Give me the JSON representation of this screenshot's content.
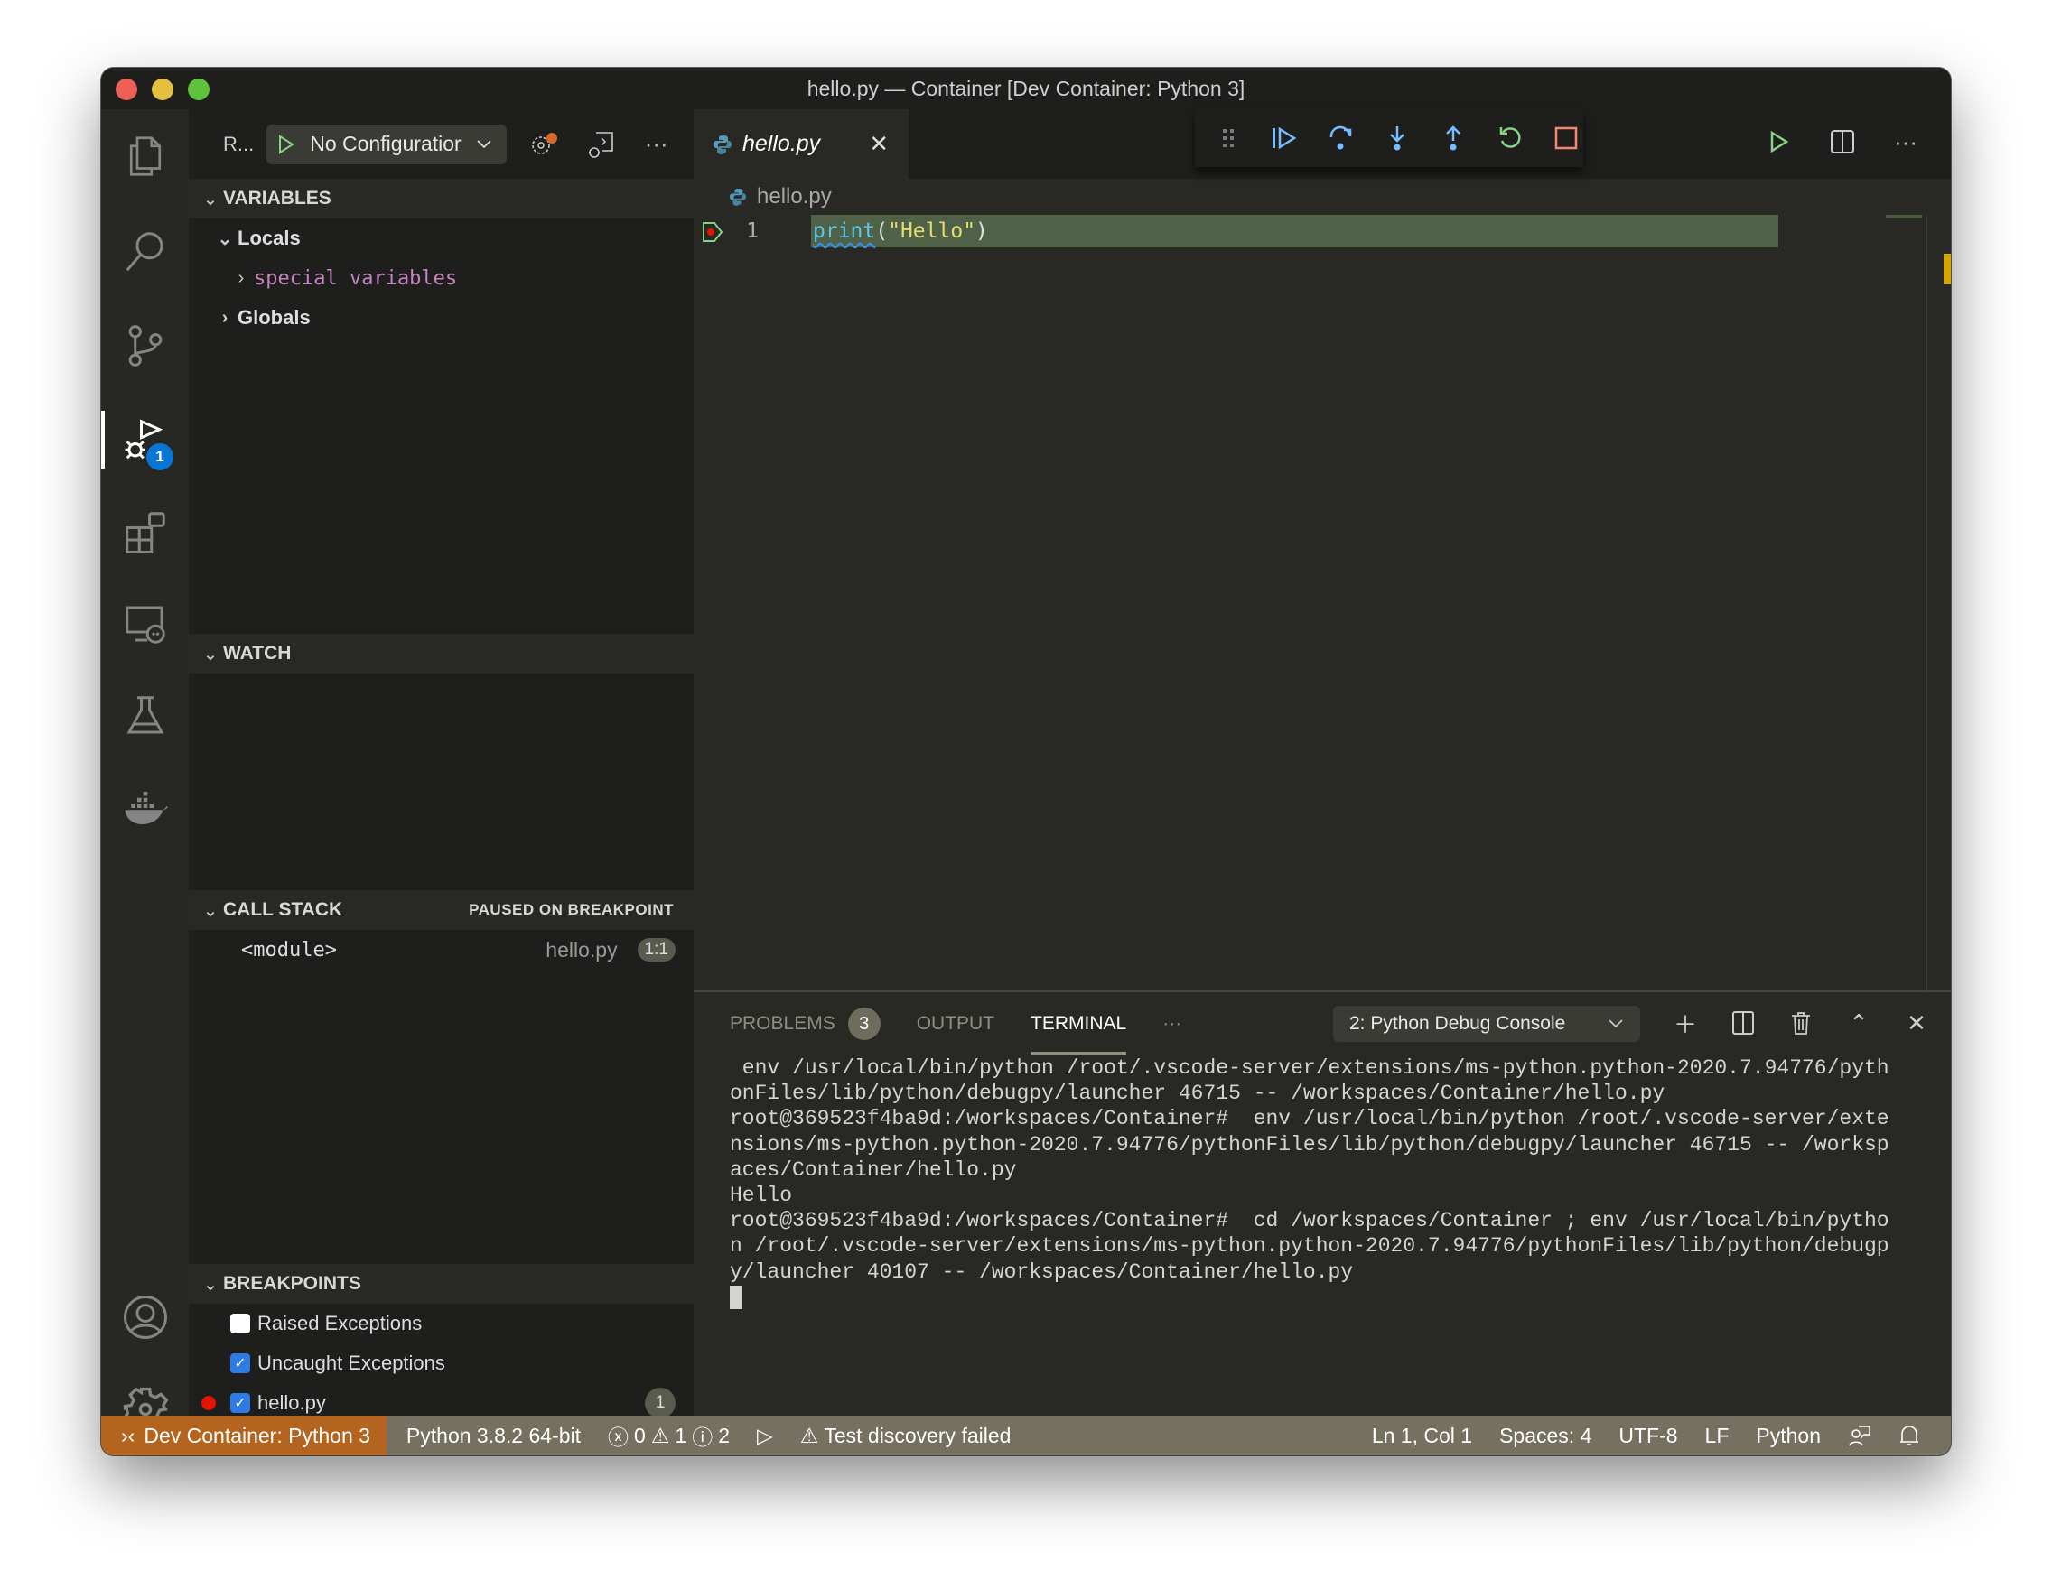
{
  "window": {
    "title": "hello.py — Container [Dev Container: Python 3]"
  },
  "activity_bar": {
    "items": [
      {
        "name": "explorer",
        "icon": "files-icon"
      },
      {
        "name": "search",
        "icon": "search-icon"
      },
      {
        "name": "source-control",
        "icon": "source-control-icon"
      },
      {
        "name": "run-debug",
        "icon": "debug-icon",
        "badge": "1",
        "active": true
      },
      {
        "name": "extensions",
        "icon": "extensions-icon"
      },
      {
        "name": "remote-explorer",
        "icon": "remote-explorer-icon"
      },
      {
        "name": "testing",
        "icon": "flask-icon"
      },
      {
        "name": "docker",
        "icon": "docker-icon"
      }
    ],
    "bottom": [
      {
        "name": "accounts",
        "icon": "account-icon"
      },
      {
        "name": "manage",
        "icon": "gear-icon"
      }
    ],
    "debug_badge": "1"
  },
  "sidebar": {
    "view_title": "R...",
    "config_label": "No Configuratior",
    "variables": {
      "title": "VARIABLES",
      "locals_label": "Locals",
      "special_variables_label": "special variables",
      "globals_label": "Globals"
    },
    "watch": {
      "title": "WATCH"
    },
    "call_stack": {
      "title": "CALL STACK",
      "status": "PAUSED ON BREAKPOINT",
      "frames": [
        {
          "name": "<module>",
          "file": "hello.py",
          "position": "1:1"
        }
      ]
    },
    "breakpoints": {
      "title": "BREAKPOINTS",
      "items": [
        {
          "label": "Raised Exceptions",
          "checked": false
        },
        {
          "label": "Uncaught Exceptions",
          "checked": true
        },
        {
          "label": "hello.py",
          "checked": true,
          "count": "1"
        }
      ]
    }
  },
  "editor": {
    "tab_label": "hello.py",
    "breadcrumb_file": "hello.py",
    "lines": [
      {
        "number": "1",
        "fn": "print",
        "open": "(",
        "str": "\"Hello\"",
        "close": ")"
      }
    ],
    "debug_toolbar": [
      "drag-handle",
      "continue",
      "step-over",
      "step-into",
      "step-out",
      "restart",
      "stop"
    ],
    "colors": {
      "debug_blue": "#75beff",
      "restart_green": "#89d185",
      "stop_red": "#f48771",
      "current_line": "#4f6146"
    }
  },
  "panel": {
    "tabs": [
      {
        "label": "PROBLEMS",
        "count": "3"
      },
      {
        "label": "OUTPUT"
      },
      {
        "label": "TERMINAL",
        "active": true
      }
    ],
    "more_label": "···",
    "terminal_select": "2: Python Debug Console",
    "terminal_lines": [
      " env /usr/local/bin/python /root/.vscode-server/extensions/ms-python.python-2020.7.94776/pyth",
      "onFiles/lib/python/debugpy/launcher 46715 -- /workspaces/Container/hello.py",
      "root@369523f4ba9d:/workspaces/Container#  env /usr/local/bin/python /root/.vscode-server/exte",
      "nsions/ms-python.python-2020.7.94776/pythonFiles/lib/python/debugpy/launcher 46715 -- /worksp",
      "aces/Container/hello.py",
      "Hello",
      "root@369523f4ba9d:/workspaces/Container#  cd /workspaces/Container ; env /usr/local/bin/pytho",
      "n /root/.vscode-server/extensions/ms-python.python-2020.7.94776/pythonFiles/lib/python/debugp",
      "y/launcher 40107 -- /workspaces/Container/hello.py"
    ]
  },
  "status_bar": {
    "remote": "Dev Container: Python 3",
    "interpreter": "Python 3.8.2 64-bit",
    "errors": "0",
    "warnings": "1",
    "infos": "2",
    "test_status": "Test discovery failed",
    "position": "Ln 1, Col 1",
    "indentation": "Spaces: 4",
    "encoding": "UTF-8",
    "eol": "LF",
    "language": "Python",
    "colors": {
      "background": "#757060",
      "remote_background": "#b3651f"
    }
  }
}
